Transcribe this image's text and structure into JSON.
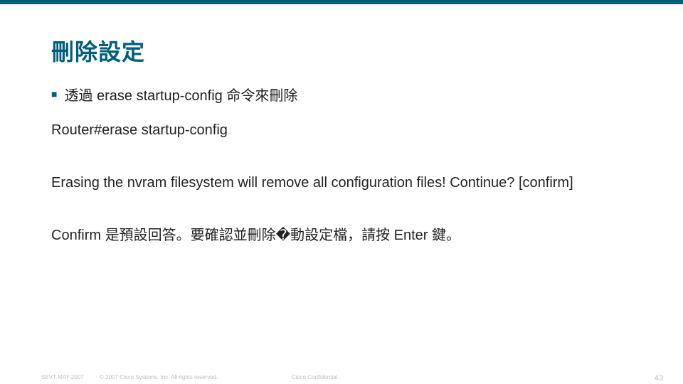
{
  "title": "刪除設定",
  "bullet": "透過 erase startup-config 命令來刪除",
  "command": "Router#erase startup-config",
  "warning": "Erasing the nvram filesystem will remove all configuration files! Continue? [confirm]",
  "confirm_note": "Confirm 是預設回答。要確認並刪除�動設定檔，請按 Enter 鍵。",
  "footer": {
    "ref": "SEVT-MAY-2007",
    "copyright": "© 2007 Cisco Systems, Inc. All rights reserved.",
    "confidential": "Cisco Confidential",
    "page": "43"
  }
}
